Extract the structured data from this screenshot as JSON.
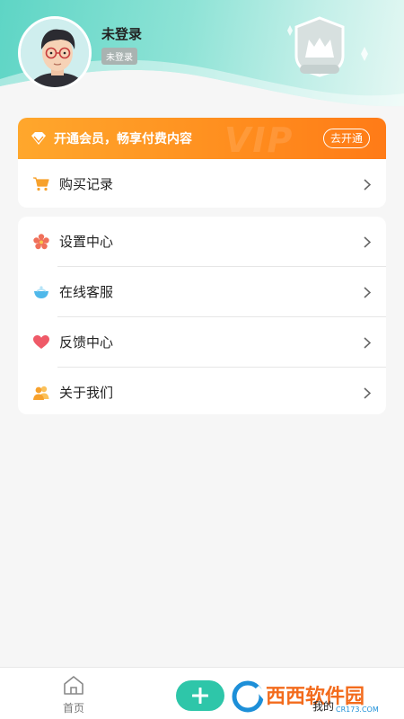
{
  "profile": {
    "name": "未登录",
    "status": "未登录"
  },
  "vip": {
    "text": "开通会员，畅享付费内容",
    "watermark": "VIP",
    "button": "去开通"
  },
  "purchase": {
    "label": "购买记录"
  },
  "menu": {
    "items": [
      {
        "label": "设置中心",
        "icon": "settings-flower-icon"
      },
      {
        "label": "在线客服",
        "icon": "service-bowl-icon"
      },
      {
        "label": "反馈中心",
        "icon": "heart-icon"
      },
      {
        "label": "关于我们",
        "icon": "users-icon"
      }
    ]
  },
  "tabbar": {
    "home": "首页",
    "mine": "我的",
    "watermark_text": "西西软件园",
    "watermark_sub": "CR173.COM"
  },
  "colors": {
    "accent": "#2ec6a9",
    "vip_orange": "#ff8d1e",
    "header_teal": "#5ed5c5"
  }
}
